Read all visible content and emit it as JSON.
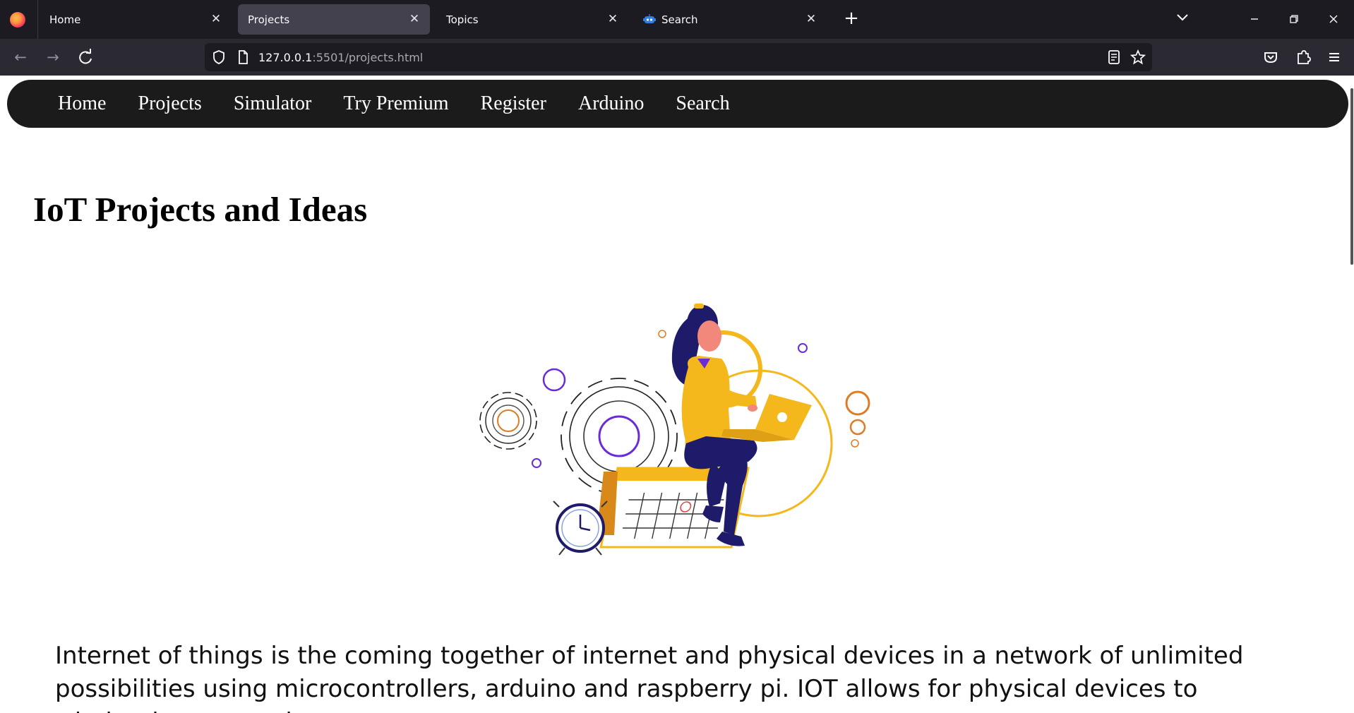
{
  "browser": {
    "tabs": [
      {
        "label": "Home",
        "active": false
      },
      {
        "label": "Projects",
        "active": true
      },
      {
        "label": "Topics",
        "active": false
      },
      {
        "label": "Search",
        "active": false,
        "icon": "robot-favicon-icon"
      }
    ],
    "new_tab_symbol": "+",
    "url_host": "127.0.0.1",
    "url_rest": ":5501/projects.html"
  },
  "site": {
    "nav": [
      "Home",
      "Projects",
      "Simulator",
      "Try Premium",
      "Register",
      "Arduino",
      "Search"
    ],
    "title": "IoT Projects and Ideas",
    "intro": "Internet of things is the coming together of internet and physical devices in a network of unlimited possibilities using microcontrollers, arduino and raspberry pi. IOT allows for physical devices to wirelessly communicate over"
  },
  "colors": {
    "tabbar_bg": "#1c1b22",
    "toolbar_bg": "#2b2a33",
    "site_nav_bg": "#1b1b1b",
    "accent_yellow": "#f5b81c",
    "accent_navy": "#1f1b6b",
    "accent_purple": "#6a2bd9",
    "accent_orange": "#e07b25"
  },
  "hero_image": {
    "icon": "woman-laptop-calendar-gears-illustration"
  }
}
